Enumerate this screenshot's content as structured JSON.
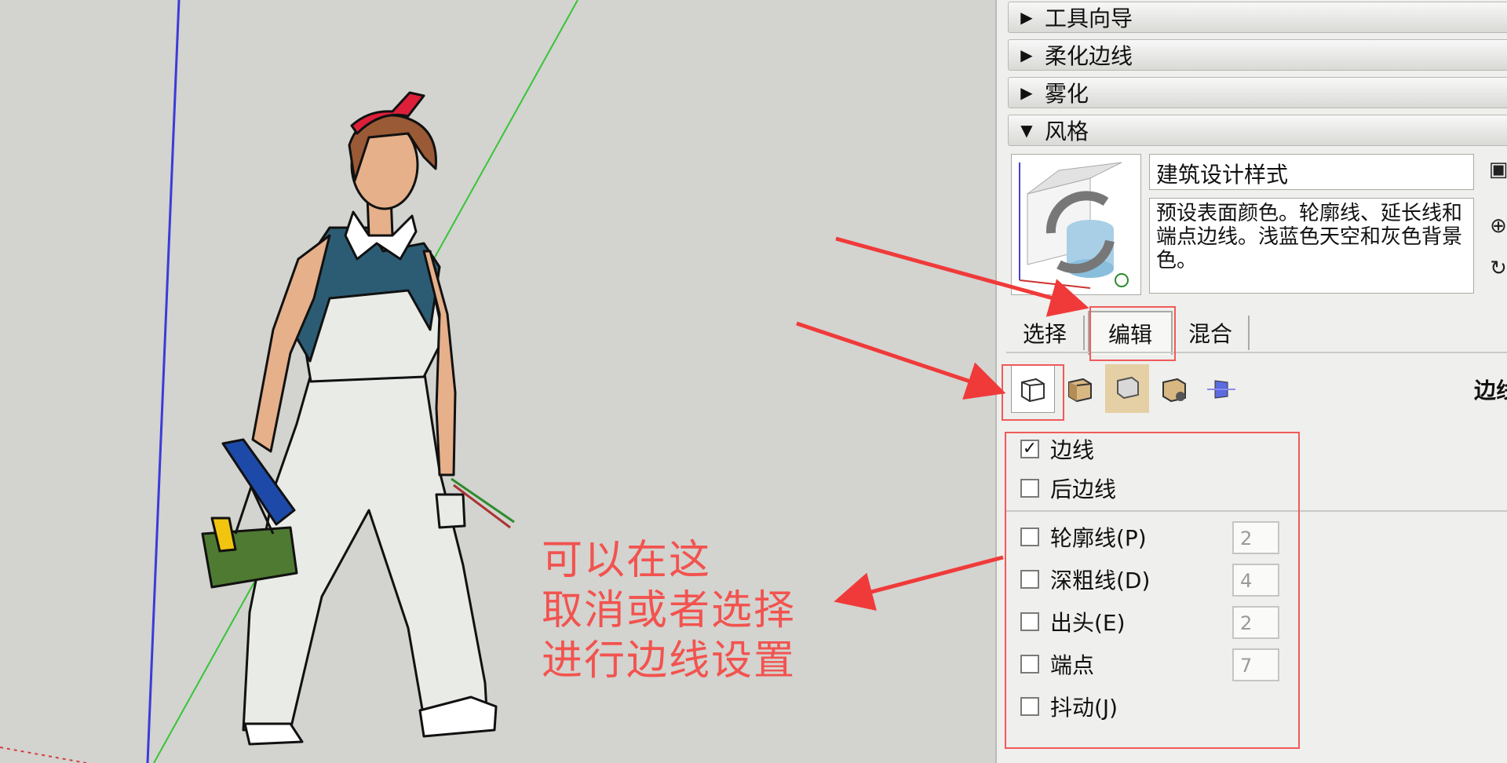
{
  "panel": {
    "sections": [
      {
        "label": "工具向导",
        "expanded": false
      },
      {
        "label": "柔化边线",
        "expanded": false
      },
      {
        "label": "雾化",
        "expanded": false
      },
      {
        "label": "风格",
        "expanded": true
      }
    ],
    "style": {
      "name": "建筑设计样式",
      "description": "预设表面颜色。轮廓线、延长线和端点边线。浅蓝色天空和灰色背景色。"
    },
    "tabs": [
      {
        "label": "选择",
        "active": false
      },
      {
        "label": "编辑",
        "active": true
      },
      {
        "label": "混合",
        "active": false
      }
    ],
    "edit_tools": [
      {
        "icon": "edge-settings-icon",
        "selected": true
      },
      {
        "icon": "face-settings-icon",
        "selected": false
      },
      {
        "icon": "background-settings-icon",
        "selected": false
      },
      {
        "icon": "watermark-settings-icon",
        "selected": false
      },
      {
        "icon": "modeling-settings-icon",
        "selected": false
      }
    ],
    "edit_title": "边线",
    "edge_options": [
      {
        "label": "边线",
        "checked": true
      },
      {
        "label": "后边线",
        "checked": false
      },
      {
        "label": "轮廓线(P)",
        "checked": false,
        "value": "2"
      },
      {
        "label": "深粗线(D)",
        "checked": false,
        "value": "4"
      },
      {
        "label": "出头(E)",
        "checked": false,
        "value": "2"
      },
      {
        "label": "端点",
        "checked": false,
        "value": "7"
      },
      {
        "label": "抖动(J)",
        "checked": false
      }
    ]
  },
  "annotation": {
    "lines": [
      "可以在这",
      "取消或者选择",
      "进行边线设置"
    ],
    "color": "#f2534f"
  },
  "colors": {
    "viewport_bg": "#d3d3cf",
    "panel_bg": "#efefed",
    "highlight": "#f05a5a",
    "axis_blue": "#3b3bd8",
    "axis_green": "#35c535"
  }
}
